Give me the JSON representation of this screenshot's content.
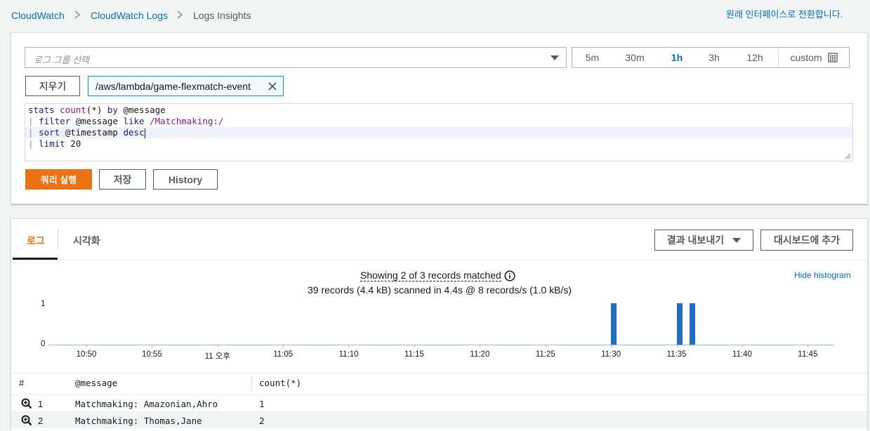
{
  "breadcrumb": {
    "items": [
      "CloudWatch",
      "CloudWatch Logs",
      "Logs Insights"
    ],
    "switch_link": "원래 인터페이스로 전환합니다."
  },
  "query": {
    "log_group_placeholder": "로그 그룹 선택",
    "time_ranges": [
      "5m",
      "30m",
      "1h",
      "3h",
      "12h"
    ],
    "active_range": "1h",
    "custom_label": "custom",
    "clear_label": "지우기",
    "selected_log_group": "/aws/lambda/game-flexmatch-event",
    "lines": [
      [
        [
          "kw",
          "stats "
        ],
        [
          "fn",
          "count"
        ],
        [
          "plain",
          "(*) "
        ],
        [
          "kw",
          "by "
        ],
        [
          "plain",
          "@message"
        ]
      ],
      [
        [
          "pipe",
          "| "
        ],
        [
          "kw",
          "filter "
        ],
        [
          "plain",
          "@message "
        ],
        [
          "kw",
          "like "
        ],
        [
          "re",
          "/Matchmaking:/"
        ]
      ],
      [
        [
          "pipe",
          "| "
        ],
        [
          "kw",
          "sort "
        ],
        [
          "plain",
          "@timestamp "
        ],
        [
          "kw",
          "desc"
        ]
      ],
      [
        [
          "pipe",
          "| "
        ],
        [
          "kw",
          "limit "
        ],
        [
          "plain",
          "20"
        ]
      ]
    ],
    "run_label": "쿼리 실행",
    "save_label": "저장",
    "history_label": "History"
  },
  "results": {
    "tabs": [
      "로그",
      "시각화"
    ],
    "export_label": "결과 내보내기",
    "add_dashboard_label": "대시보드에 추가",
    "summary_line1": "Showing 2 of 3 records matched",
    "summary_line2": "39 records (4.4 kB) scanned in 4.4s @ 8 records/s (1.0 kB/s)",
    "hide_histogram_label": "Hide histogram",
    "columns": [
      "#",
      "@message",
      "count(*)"
    ],
    "rows": [
      {
        "num": "1",
        "message": "Matchmaking: Amazonian,Ahro",
        "count": "1"
      },
      {
        "num": "2",
        "message": "Matchmaking: Thomas,Jane",
        "count": "2"
      }
    ]
  },
  "chart_data": {
    "type": "bar",
    "x_ticks": [
      "10:50",
      "10:55",
      "11 오후",
      "11:05",
      "11:10",
      "11:15",
      "11:20",
      "11:25",
      "11:30",
      "11:35",
      "11:40",
      "11:45"
    ],
    "y_ticks": [
      "1",
      "0"
    ],
    "ylim": [
      0,
      1
    ],
    "series": [
      {
        "x": [
          "11:30",
          "11:35",
          "11:36"
        ],
        "values": [
          1,
          1,
          1
        ]
      }
    ],
    "bar_color": "#1f6fc5"
  }
}
